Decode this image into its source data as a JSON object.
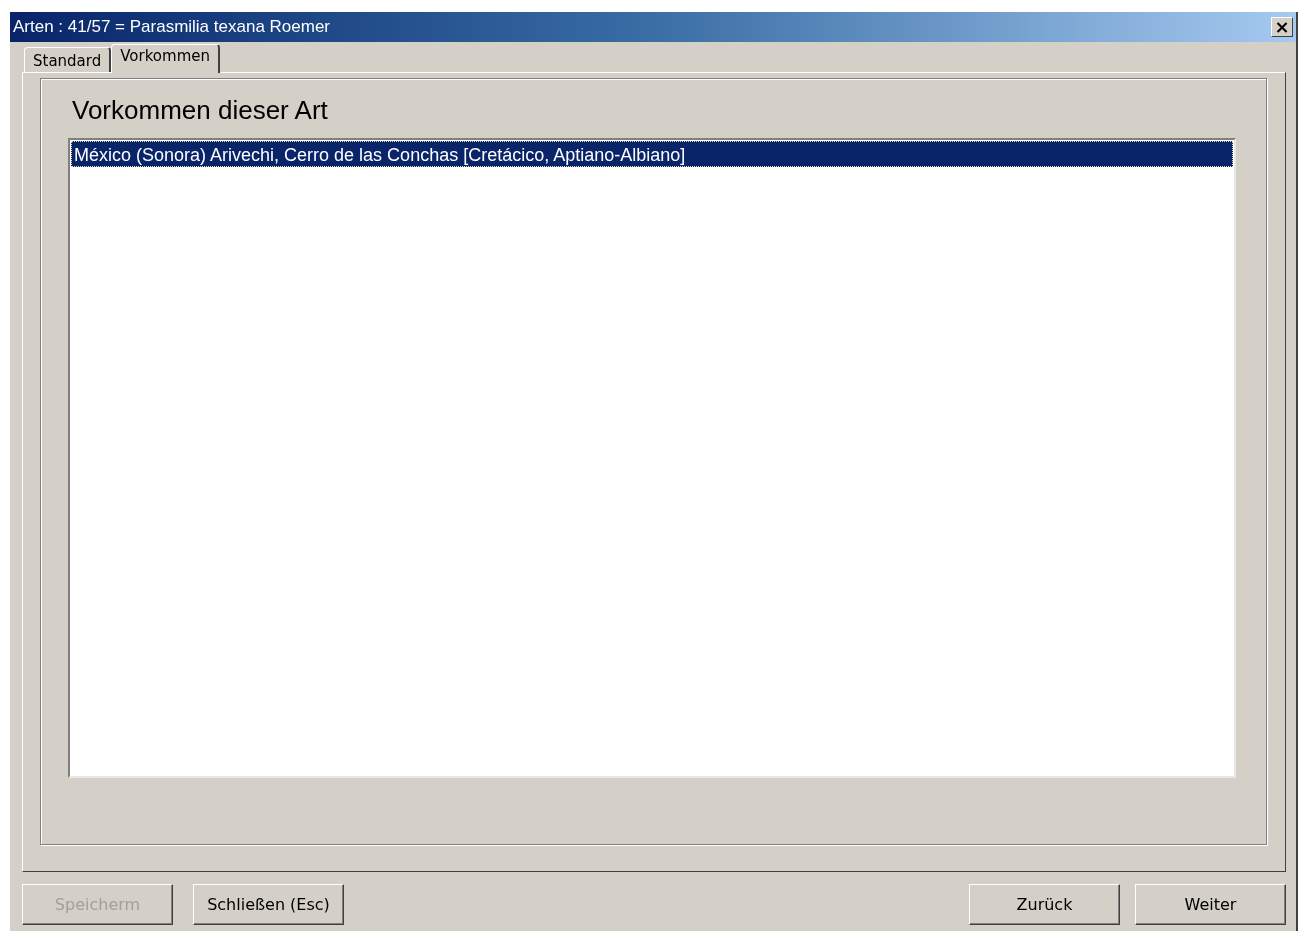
{
  "window": {
    "title": "Arten : 41/57 = Parasmilia texana Roemer",
    "close": "×"
  },
  "tabs": [
    {
      "label": "Standard",
      "selected": false
    },
    {
      "label": "Vorkommen",
      "selected": true
    }
  ],
  "panel": {
    "heading": "Vorkommen dieser Art",
    "list": [
      {
        "text": "México (Sonora) Arivechi, Cerro de las Conchas [Cretácico, Aptiano-Albiano]",
        "selected": true
      }
    ]
  },
  "buttons_left": [
    {
      "label": "Speicherm",
      "disabled": true
    },
    {
      "label": "Schließen (Esc)",
      "disabled": false
    }
  ],
  "buttons_right": [
    {
      "label": "Zurück",
      "disabled": false
    },
    {
      "label": "Weiter",
      "disabled": false
    }
  ]
}
